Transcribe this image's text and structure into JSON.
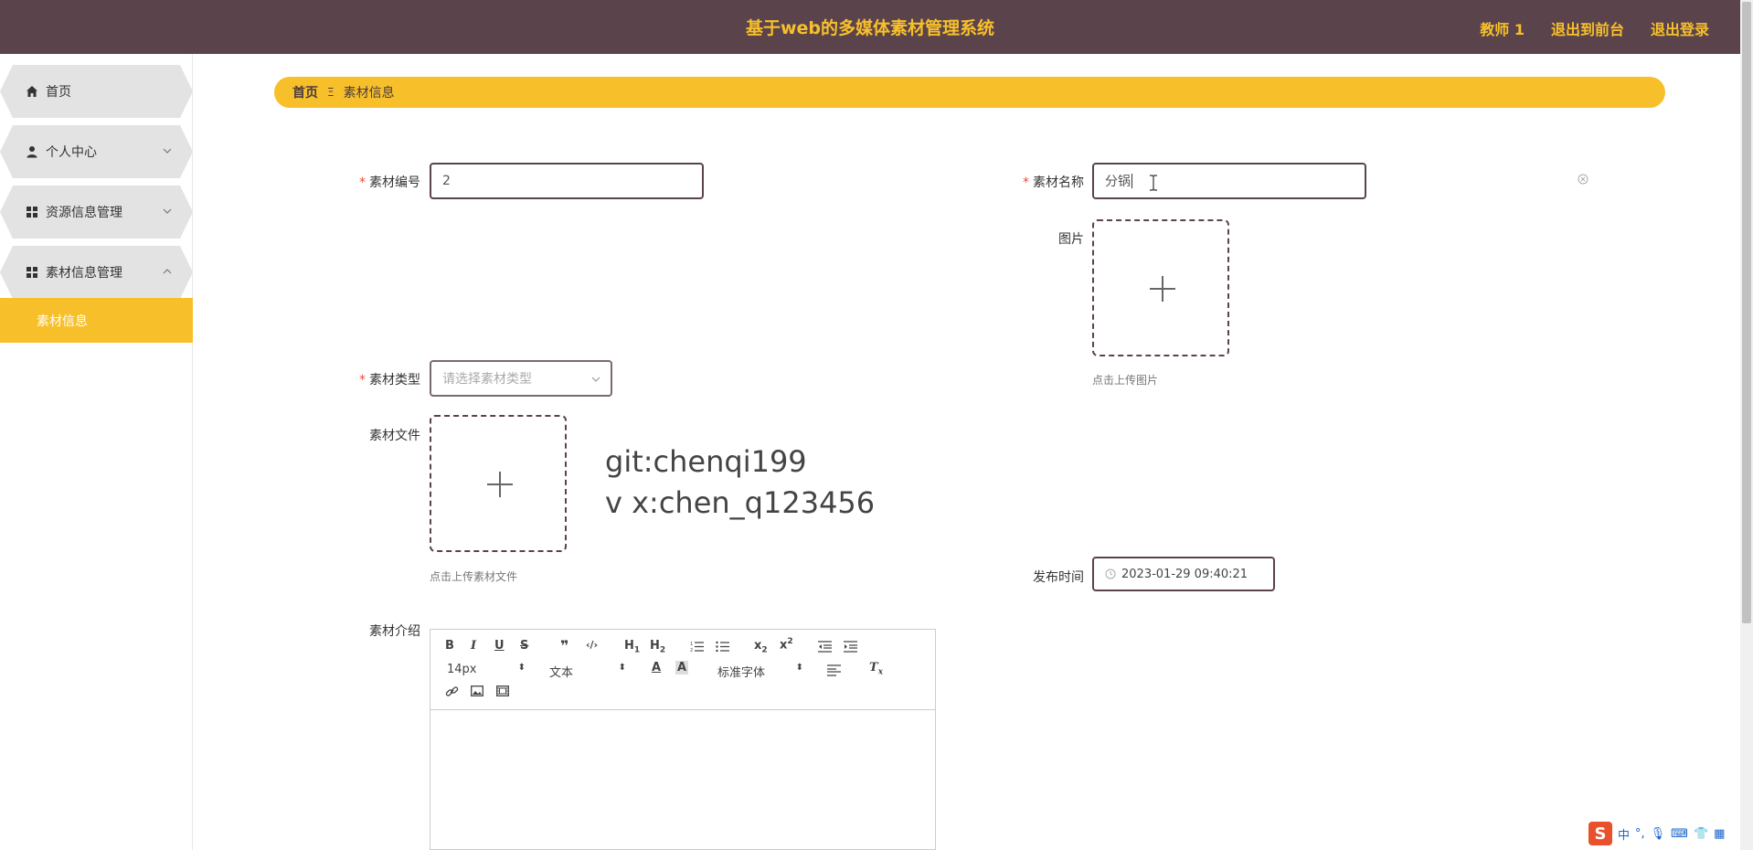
{
  "header": {
    "title": "基于web的多媒体素材管理系统",
    "user": "教师 1",
    "back_front": "退出到前台",
    "logout": "退出登录"
  },
  "sidebar": {
    "items": [
      {
        "label": "首页",
        "icon": "home-icon"
      },
      {
        "label": "个人中心",
        "icon": "user-icon"
      },
      {
        "label": "资源信息管理",
        "icon": "grid-icon"
      },
      {
        "label": "素材信息管理",
        "icon": "grid-icon"
      }
    ],
    "active_sub": "素材信息"
  },
  "breadcrumb": {
    "home": "首页",
    "sep": "Ξ",
    "current": "素材信息"
  },
  "form": {
    "code_label": "素材编号",
    "code_value": "2",
    "name_label": "素材名称",
    "name_value": "分锅",
    "image_label": "图片",
    "image_hint": "点击上传图片",
    "type_label": "素材类型",
    "type_placeholder": "请选择素材类型",
    "file_label": "素材文件",
    "file_hint": "点击上传素材文件",
    "time_label": "发布时间",
    "time_value": "2023-01-29 09:40:21",
    "intro_label": "素材介绍"
  },
  "overlay": {
    "line1": "git:chenqi199",
    "line2": "v x:chen_q123456"
  },
  "editor": {
    "font_size": "14px",
    "paragraph": "文本",
    "font_family": "标准字体"
  },
  "ime": {
    "mode": "中"
  },
  "colors": {
    "header_bg": "#5b434b",
    "accent": "#f7c02b",
    "menu_bg": "#e3e3e3"
  }
}
